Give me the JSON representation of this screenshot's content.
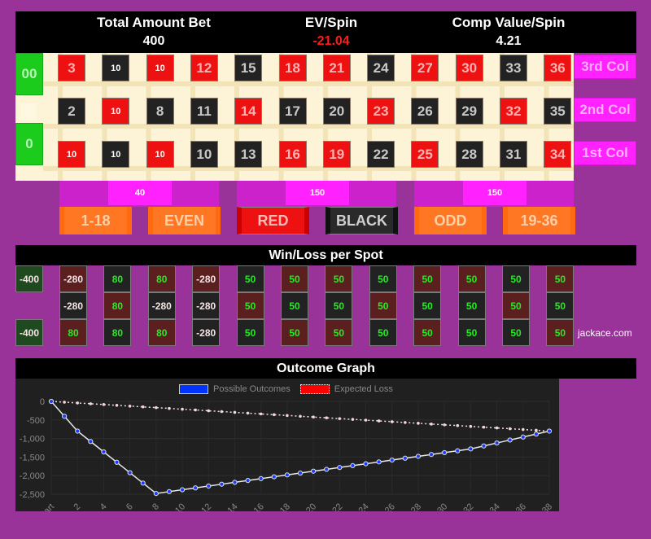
{
  "header": {
    "total_bet_label": "Total Amount Bet",
    "total_bet_value": "400",
    "ev_label": "EV/Spin",
    "ev_value": "-21.04",
    "comp_label": "Comp Value/Spin",
    "comp_value": "4.21"
  },
  "zeros": [
    {
      "label": "00"
    },
    {
      "label": "0"
    }
  ],
  "grid": {
    "rows": [
      [
        {
          "t": "3",
          "c": "red"
        },
        {
          "t": "10",
          "c": "black",
          "chip": true
        },
        {
          "t": "10",
          "c": "red",
          "chip": true
        },
        {
          "t": "12",
          "c": "red"
        },
        {
          "t": "15",
          "c": "black"
        },
        {
          "t": "18",
          "c": "red"
        },
        {
          "t": "21",
          "c": "red"
        },
        {
          "t": "24",
          "c": "black"
        },
        {
          "t": "27",
          "c": "red"
        },
        {
          "t": "30",
          "c": "red"
        },
        {
          "t": "33",
          "c": "black"
        },
        {
          "t": "36",
          "c": "red"
        }
      ],
      [
        {
          "t": "2",
          "c": "black"
        },
        {
          "t": "10",
          "c": "red",
          "chip": true
        },
        {
          "t": "8",
          "c": "black"
        },
        {
          "t": "11",
          "c": "black"
        },
        {
          "t": "14",
          "c": "red"
        },
        {
          "t": "17",
          "c": "black"
        },
        {
          "t": "20",
          "c": "black"
        },
        {
          "t": "23",
          "c": "red"
        },
        {
          "t": "26",
          "c": "black"
        },
        {
          "t": "29",
          "c": "black"
        },
        {
          "t": "32",
          "c": "red"
        },
        {
          "t": "35",
          "c": "black"
        }
      ],
      [
        {
          "t": "10",
          "c": "red",
          "chip": true
        },
        {
          "t": "10",
          "c": "black",
          "chip": true
        },
        {
          "t": "10",
          "c": "red",
          "chip": true
        },
        {
          "t": "10",
          "c": "black"
        },
        {
          "t": "13",
          "c": "black"
        },
        {
          "t": "16",
          "c": "red"
        },
        {
          "t": "19",
          "c": "red"
        },
        {
          "t": "22",
          "c": "black"
        },
        {
          "t": "25",
          "c": "red"
        },
        {
          "t": "28",
          "c": "black"
        },
        {
          "t": "31",
          "c": "black"
        },
        {
          "t": "34",
          "c": "red"
        }
      ]
    ]
  },
  "columns": [
    "3rd Col",
    "2nd Col",
    "1st Col"
  ],
  "dozens": [
    "40",
    "150",
    "150"
  ],
  "even_bets": [
    {
      "label": "1-18",
      "style": "orange"
    },
    {
      "label": "EVEN",
      "style": "orange"
    },
    {
      "label": "RED",
      "style": "red"
    },
    {
      "label": "BLACK",
      "style": "black"
    },
    {
      "label": "ODD",
      "style": "orange"
    },
    {
      "label": "19-36",
      "style": "orange"
    }
  ],
  "winloss": {
    "title": "Win/Loss per Spot",
    "zeros": [
      "-400",
      "-400"
    ],
    "rows": [
      [
        "-280",
        "80",
        "80",
        "-280",
        "50",
        "50",
        "50",
        "50",
        "50",
        "50",
        "50",
        "50"
      ],
      [
        "-280",
        "80",
        "-280",
        "-280",
        "50",
        "50",
        "50",
        "50",
        "50",
        "50",
        "50",
        "50"
      ],
      [
        "80",
        "80",
        "80",
        "-280",
        "50",
        "50",
        "50",
        "50",
        "50",
        "50",
        "50",
        "50"
      ]
    ],
    "row_colors": [
      [
        "dr",
        "dk",
        "dr",
        "dr",
        "dk",
        "dr",
        "dr",
        "dk",
        "dr",
        "dr",
        "dk",
        "dr"
      ],
      [
        "dk",
        "dr",
        "dk",
        "dk",
        "dr",
        "dk",
        "dk",
        "dr",
        "dk",
        "dk",
        "dr",
        "dk"
      ],
      [
        "dr",
        "dk",
        "dr",
        "dk",
        "dk",
        "dr",
        "dr",
        "dk",
        "dr",
        "dk",
        "dk",
        "dr"
      ]
    ],
    "site": "jackace.com"
  },
  "graph": {
    "title": "Outcome Graph",
    "legend": [
      "Possible Outcomes",
      "Expected Loss"
    ]
  },
  "chart_data": {
    "type": "line",
    "title": "Outcome Graph",
    "x": [
      0,
      1,
      2,
      3,
      4,
      5,
      6,
      7,
      8,
      9,
      10,
      11,
      12,
      13,
      14,
      15,
      16,
      17,
      18,
      19,
      20,
      21,
      22,
      23,
      24,
      25,
      26,
      27,
      28,
      29,
      30,
      31,
      32,
      33,
      34,
      35,
      36,
      37,
      38
    ],
    "xtick_labels": [
      "Start",
      "2",
      "4",
      "6",
      "8",
      "10",
      "12",
      "14",
      "16",
      "18",
      "20",
      "22",
      "24",
      "26",
      "28",
      "30",
      "32",
      "34",
      "36",
      "38"
    ],
    "yticks": [
      0,
      -500,
      -1000,
      -1500,
      -2000,
      -2500
    ],
    "ytick_labels": [
      "0",
      "-500",
      "-1,000",
      "-1,500",
      "-2,000",
      "-2,500"
    ],
    "ylim": [
      -2500,
      0
    ],
    "xlim": [
      0,
      38
    ],
    "grid": true,
    "legend_position": "top",
    "series": [
      {
        "name": "Possible Outcomes",
        "color": "#0033ff",
        "values": [
          0,
          -400,
          -800,
          -1080,
          -1360,
          -1640,
          -1920,
          -2200,
          -2480,
          -2430,
          -2380,
          -2330,
          -2280,
          -2230,
          -2180,
          -2130,
          -2080,
          -2030,
          -1980,
          -1930,
          -1880,
          -1830,
          -1780,
          -1730,
          -1680,
          -1630,
          -1580,
          -1530,
          -1480,
          -1430,
          -1380,
          -1330,
          -1280,
          -1200,
          -1120,
          -1040,
          -960,
          -880,
          -800
        ]
      },
      {
        "name": "Expected Loss",
        "color": "#ff0000",
        "values": [
          0,
          -21,
          -42,
          -63,
          -84,
          -105,
          -126,
          -147,
          -168,
          -189,
          -210,
          -231,
          -252,
          -274,
          -295,
          -316,
          -337,
          -358,
          -379,
          -400,
          -421,
          -442,
          -463,
          -484,
          -505,
          -526,
          -547,
          -568,
          -589,
          -610,
          -631,
          -652,
          -673,
          -694,
          -715,
          -736,
          -757,
          -778,
          -800
        ]
      }
    ]
  }
}
